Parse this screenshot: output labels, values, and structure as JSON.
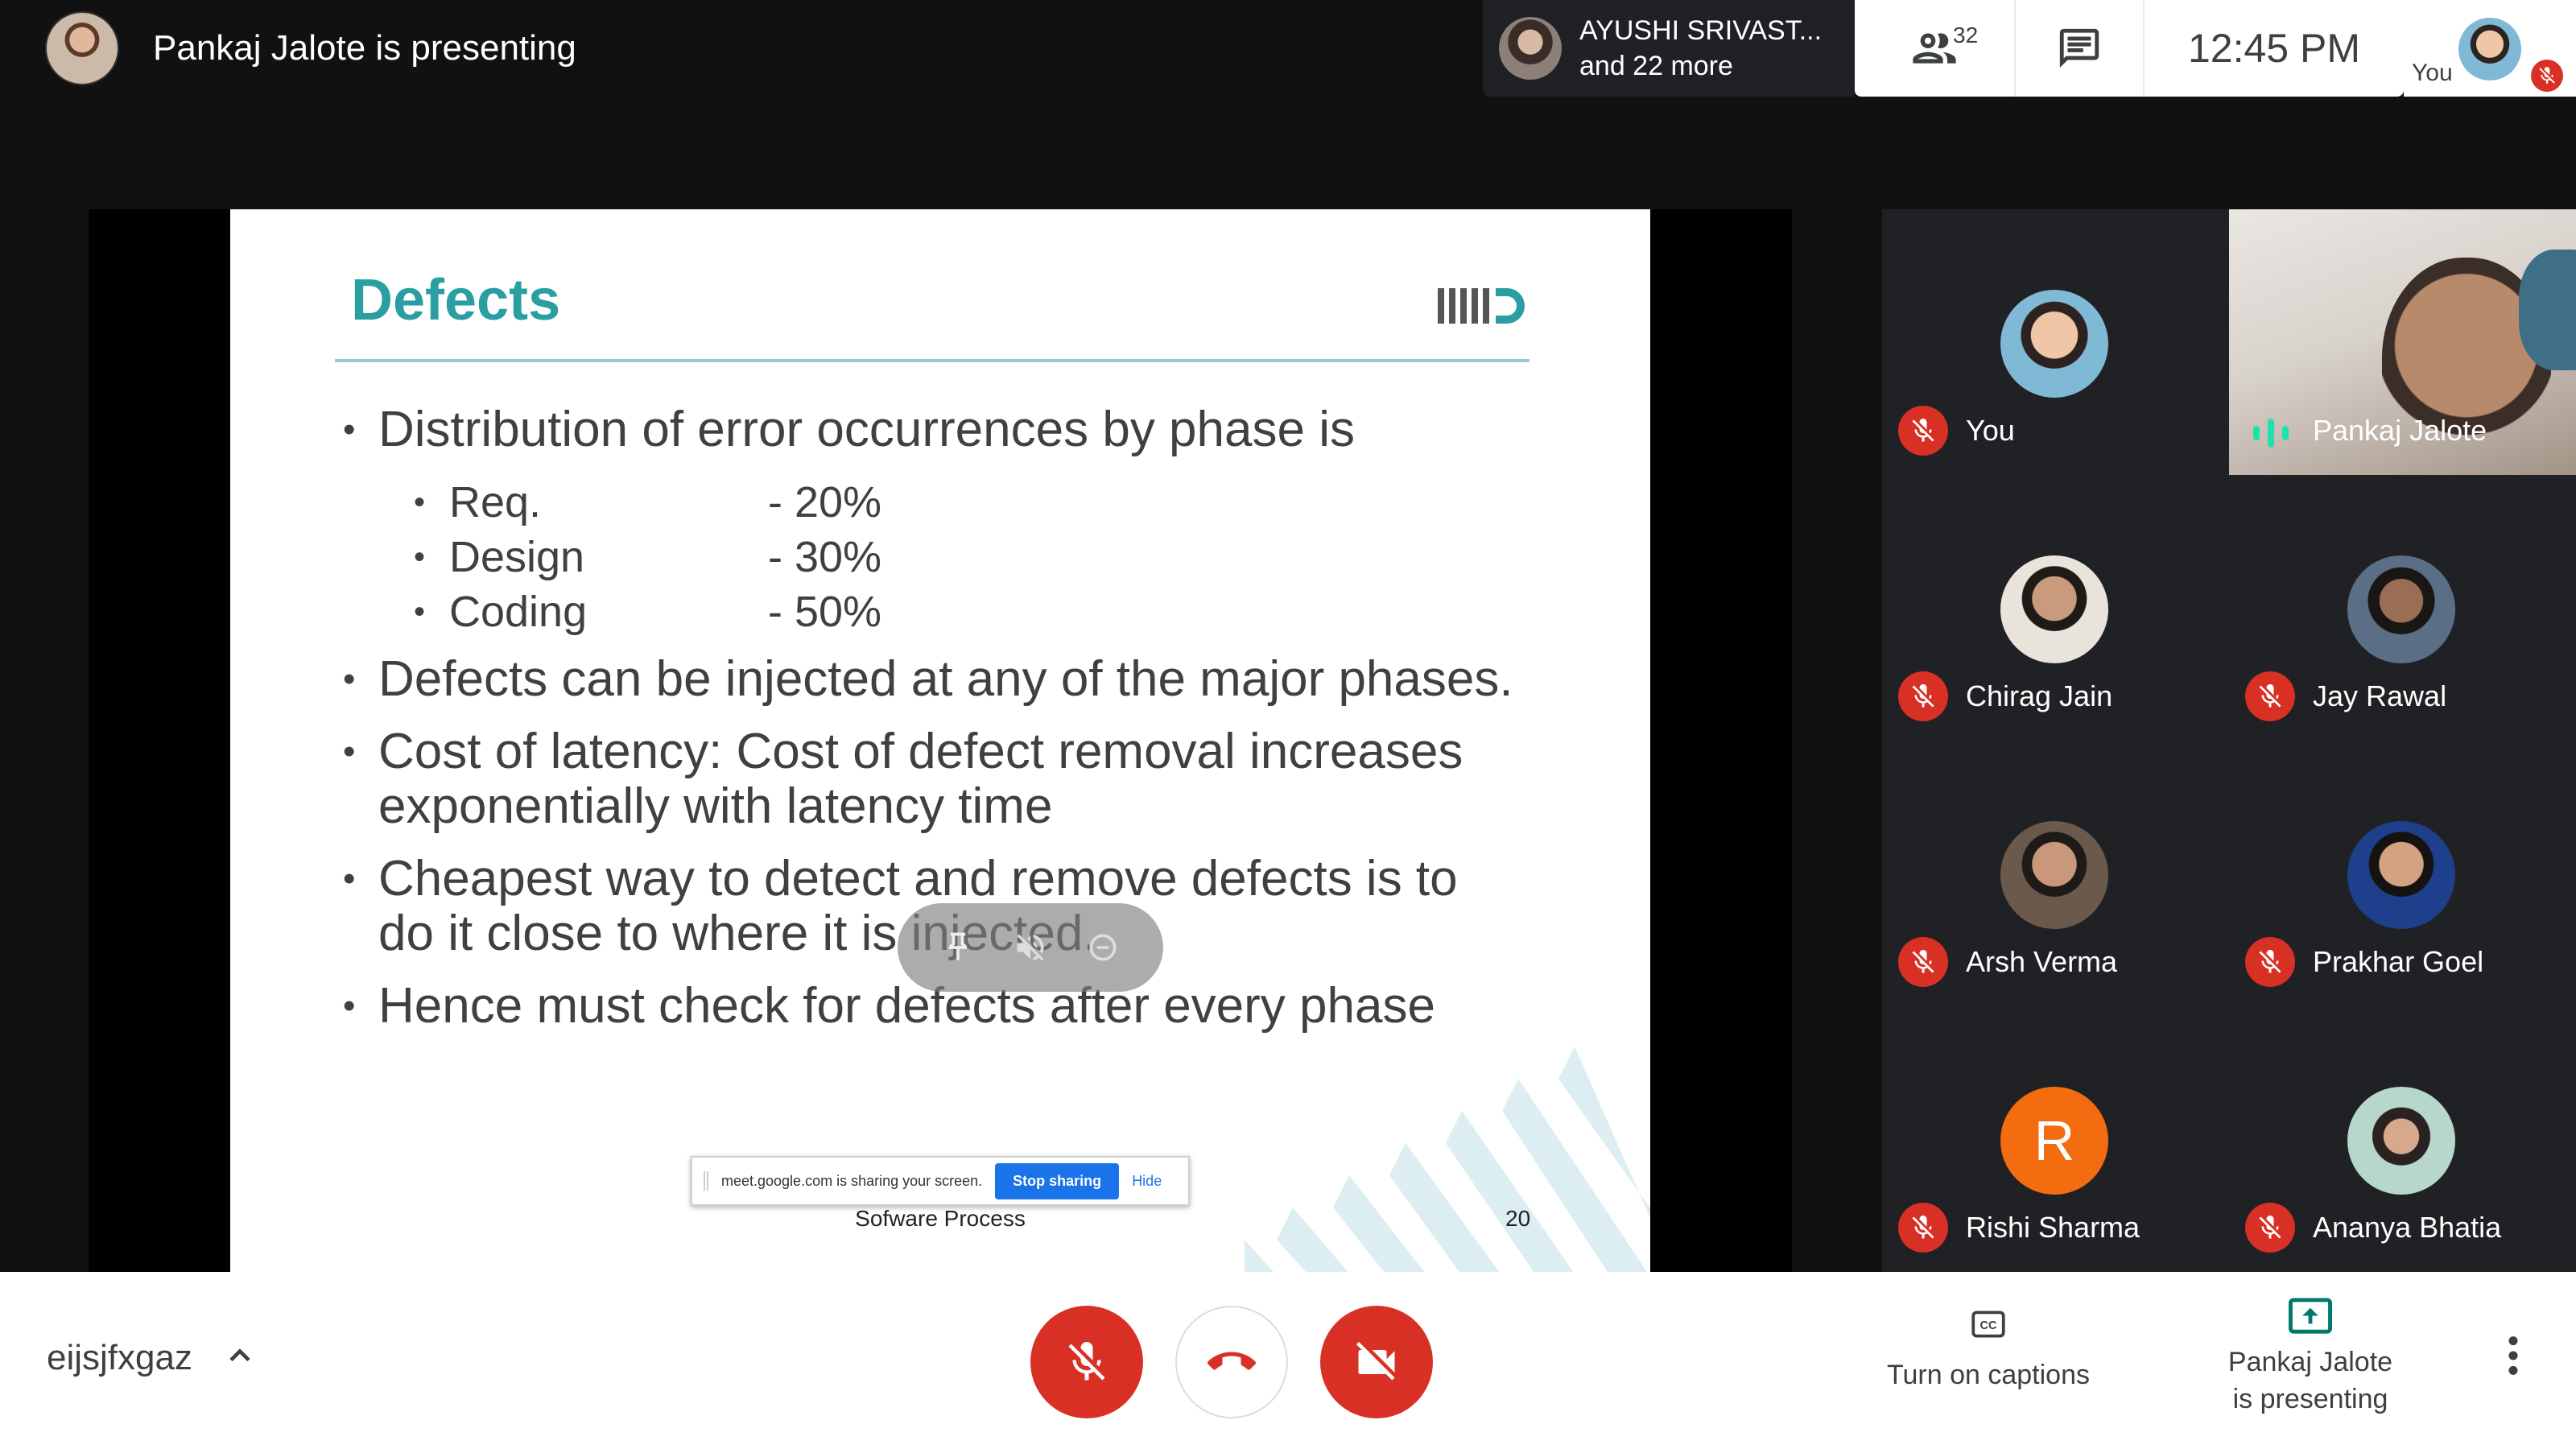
{
  "header": {
    "presenting_text": "Pankaj Jalote is presenting",
    "others_name": "AYUSHI SRIVAST...",
    "others_more": "and 22 more",
    "people_count": "32",
    "clock": "12:45 PM",
    "self_label": "You"
  },
  "slide": {
    "title": "Defects",
    "bullets": [
      "Distribution of error occurrences by phase is",
      "Defects can be injected at any of the major phases.",
      "Cost of latency: Cost of defect removal increases exponentially with latency time",
      "Cheapest way to detect and remove defects is to do it close to where it is injected.",
      "Hence must check for defects after every phase"
    ],
    "sub_items": [
      {
        "name": "Req.",
        "value": "- 20%"
      },
      {
        "name": "Design",
        "value": "- 30%"
      },
      {
        "name": "Coding",
        "value": "- 50%"
      }
    ],
    "footer": "Sofware Process",
    "page": "20"
  },
  "share_bar": {
    "text": "meet.google.com is sharing your screen.",
    "stop_label": "Stop sharing",
    "hide_label": "Hide"
  },
  "participants": [
    {
      "name": "You"
    },
    {
      "name": "Pankaj Jalote"
    },
    {
      "name": "Chirag Jain"
    },
    {
      "name": "Jay Rawal"
    },
    {
      "name": "Arsh Verma"
    },
    {
      "name": "Prakhar Goel"
    },
    {
      "name": "Rishi Sharma",
      "initial": "R"
    },
    {
      "name": "Ananya Bhatia"
    }
  ],
  "bottom": {
    "meeting_code": "eijsjfxgaz",
    "captions_label": "Turn on captions",
    "presenting_line1": "Pankaj Jalote",
    "presenting_line2": "is presenting"
  },
  "colors": {
    "mute_red": "#d93025",
    "slide_title": "#2a9ea0",
    "speaking_green": "#1ee2a7",
    "avatar_orange": "#f36c0f",
    "present_teal": "#00796b"
  },
  "icons": [
    "people-icon",
    "chat-icon",
    "mic-off-icon",
    "hang-up-icon",
    "camera-off-icon",
    "captions-icon",
    "present-icon",
    "more-vert-icon",
    "chevron-up-icon"
  ]
}
